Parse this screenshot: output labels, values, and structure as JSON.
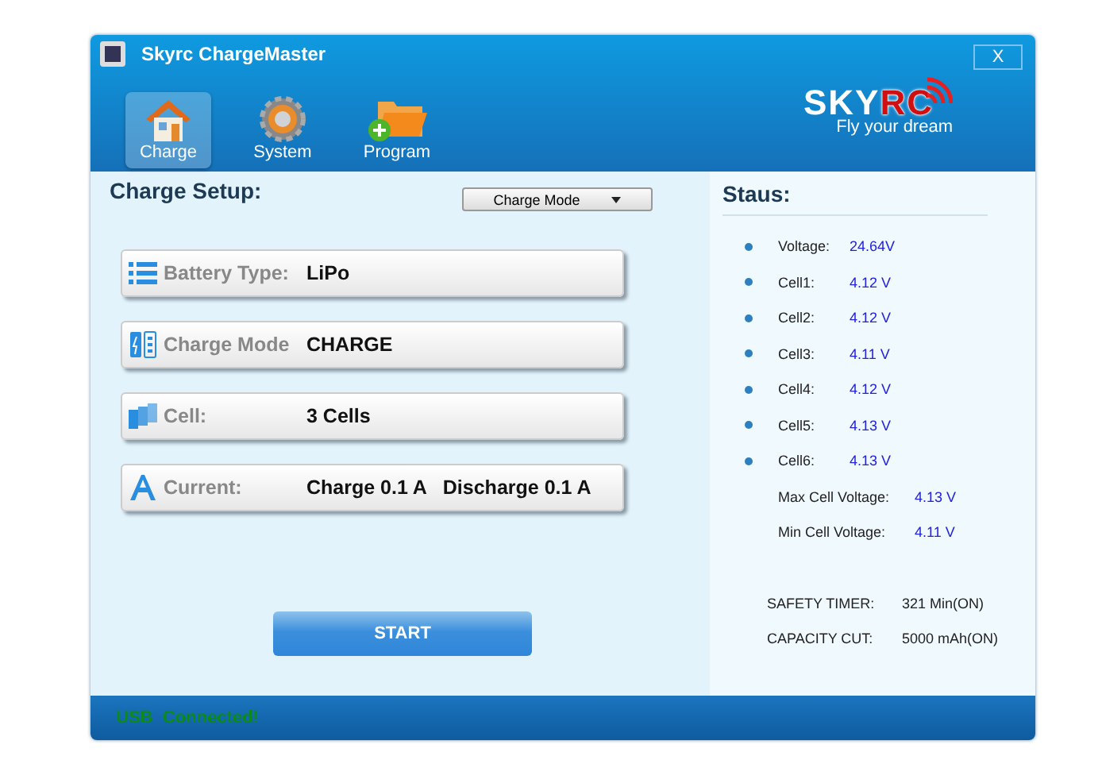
{
  "window": {
    "title": "Skyrc ChargeMaster",
    "close": "X"
  },
  "toolbar": [
    {
      "label": "Charge",
      "kind": "home",
      "selected": true
    },
    {
      "label": "System",
      "kind": "gear",
      "selected": false
    },
    {
      "label": "Program",
      "kind": "folder",
      "selected": false
    }
  ],
  "logo": {
    "brand_a": "SKY",
    "brand_b": "RC",
    "tagline": "Fly your dream"
  },
  "setup": {
    "title": "Charge Setup:",
    "mode_select": "Charge Mode",
    "rows": [
      {
        "kind": "list",
        "label": "Battery Type:",
        "value": "LiPo"
      },
      {
        "kind": "battery",
        "label": "Charge Mode",
        "value": "CHARGE"
      },
      {
        "kind": "cells",
        "label": "Cell:",
        "value": "3 Cells"
      },
      {
        "kind": "current",
        "label": "Current:",
        "value": "Charge 0.1 A   Discharge 0.1 A"
      }
    ],
    "start": "START"
  },
  "status": {
    "title": "Staus:",
    "readings": [
      {
        "label": "Voltage:",
        "value": "24.64V"
      },
      {
        "label": "Cell1:",
        "value": "4.12 V"
      },
      {
        "label": "Cell2:",
        "value": "4.12 V"
      },
      {
        "label": "Cell3:",
        "value": "4.11 V"
      },
      {
        "label": "Cell4:",
        "value": "4.12 V"
      },
      {
        "label": "Cell5:",
        "value": "4.13 V"
      },
      {
        "label": "Cell6:",
        "value": "4.13 V"
      }
    ],
    "extremes": [
      {
        "label": "Max Cell Voltage:",
        "value": "4.13 V"
      },
      {
        "label": "Min Cell Voltage:",
        "value": "4.11 V"
      }
    ],
    "settings": [
      {
        "label": "SAFETY TIMER:",
        "value": "321 Min(ON)"
      },
      {
        "label": "CAPACITY CUT:",
        "value": "5000 mAh(ON)"
      }
    ]
  },
  "status_bar": "USB  Connected!"
}
